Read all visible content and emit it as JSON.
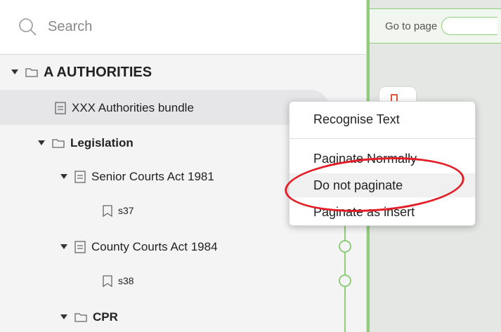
{
  "search": {
    "placeholder": "Search",
    "icon": "search-icon"
  },
  "tree": {
    "root": {
      "label": "A AUTHORITIES",
      "icon": "folder-icon"
    },
    "selected": {
      "label": "XXX Authorities bundle",
      "icon": "document-icon"
    },
    "legislation": {
      "label": "Legislation",
      "icon": "folder-icon"
    },
    "senior": {
      "label": "Senior Courts Act 1981",
      "icon": "document-icon"
    },
    "s37": {
      "label": "s37",
      "icon": "bookmark-icon"
    },
    "county": {
      "label": "County Courts Act 1984",
      "icon": "document-icon"
    },
    "s38": {
      "label": "s38",
      "icon": "bookmark-icon"
    },
    "cpr": {
      "label": "CPR",
      "icon": "folder-icon"
    }
  },
  "toolbar": {
    "goto_label": "Go to page"
  },
  "context_menu": {
    "items": [
      {
        "label": "Recognise Text"
      },
      {
        "label": "Paginate Normally"
      },
      {
        "label": "Do not paginate"
      },
      {
        "label": "Paginate as insert"
      }
    ]
  },
  "colors": {
    "accent_green": "#8fcd7b",
    "annotation_red": "#e41e26"
  }
}
